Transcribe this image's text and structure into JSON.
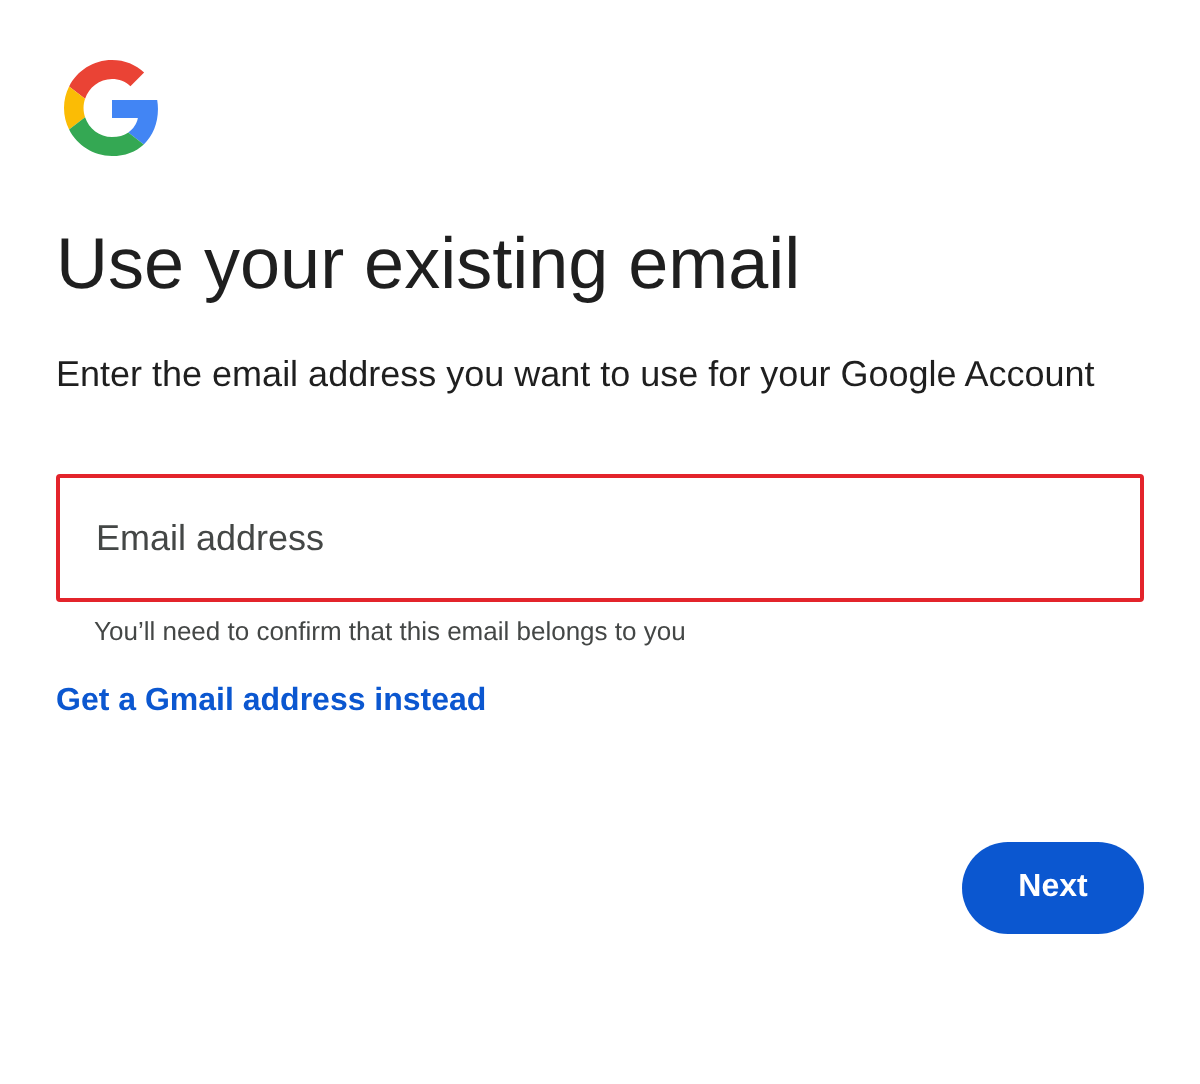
{
  "title": "Use your existing email",
  "subtitle": "Enter the email address you want to use for your Google Account",
  "email_field": {
    "placeholder": "Email address",
    "error": true
  },
  "helper_text": "You’ll need to confirm that this email belongs to you",
  "link": "Get a Gmail address instead",
  "next_button": "Next"
}
